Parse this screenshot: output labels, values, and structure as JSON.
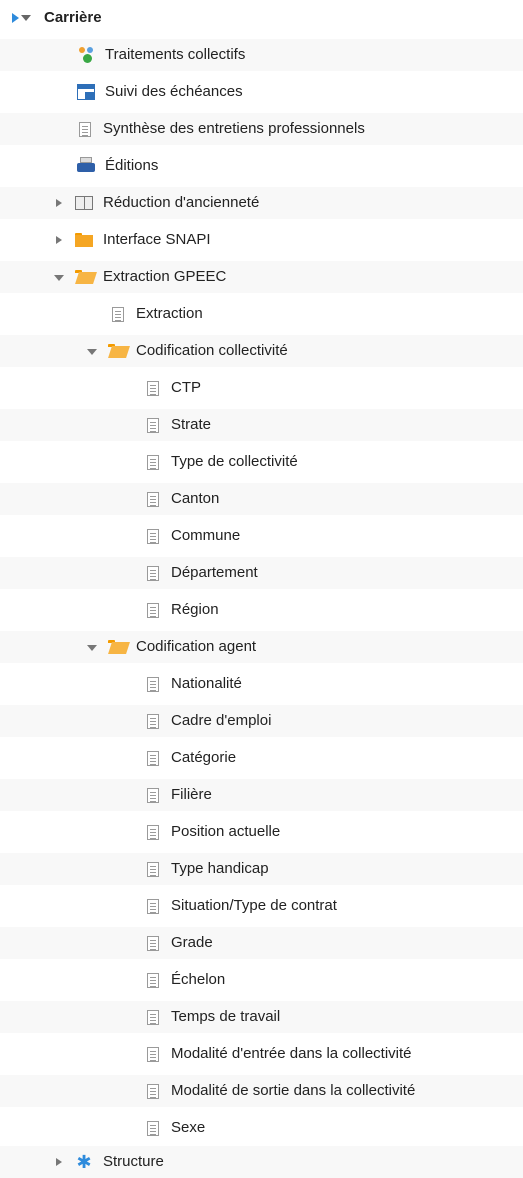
{
  "tree": {
    "root": {
      "label": "Carrière"
    },
    "items": [
      {
        "label": "Traitements collectifs",
        "icon": "team-cog-icon"
      },
      {
        "label": "Suivi des échéances",
        "icon": "calendar-icon"
      },
      {
        "label": "Synthèse des entretiens professionnels",
        "icon": "document-icon"
      },
      {
        "label": "Éditions",
        "icon": "printer-icon"
      },
      {
        "label": "Réduction d'ancienneté",
        "icon": "book-icon"
      },
      {
        "label": "Interface SNAPI",
        "icon": "folder-icon"
      },
      {
        "label": "Extraction GPEEC",
        "icon": "folder-open-icon"
      },
      {
        "label": "Extraction",
        "icon": "document-icon"
      },
      {
        "label": "Codification collectivité",
        "icon": "folder-open-icon"
      },
      {
        "label": "CTP",
        "icon": "document-icon"
      },
      {
        "label": "Strate",
        "icon": "document-icon"
      },
      {
        "label": "Type de collectivité",
        "icon": "document-icon"
      },
      {
        "label": "Canton",
        "icon": "document-icon"
      },
      {
        "label": "Commune",
        "icon": "document-icon"
      },
      {
        "label": "Département",
        "icon": "document-icon"
      },
      {
        "label": "Région",
        "icon": "document-icon"
      },
      {
        "label": "Codification agent",
        "icon": "folder-open-icon"
      },
      {
        "label": "Nationalité",
        "icon": "document-icon"
      },
      {
        "label": "Cadre d'emploi",
        "icon": "document-icon"
      },
      {
        "label": "Catégorie",
        "icon": "document-icon"
      },
      {
        "label": "Filière",
        "icon": "document-icon"
      },
      {
        "label": "Position actuelle",
        "icon": "document-icon"
      },
      {
        "label": "Type handicap",
        "icon": "document-icon"
      },
      {
        "label": "Situation/Type de contrat",
        "icon": "document-icon"
      },
      {
        "label": "Grade",
        "icon": "document-icon"
      },
      {
        "label": "Échelon",
        "icon": "document-icon"
      },
      {
        "label": "Temps de travail",
        "icon": "document-icon"
      },
      {
        "label": "Modalité d'entrée dans la collectivité",
        "icon": "document-icon"
      },
      {
        "label": "Modalité de sortie dans la collectivité",
        "icon": "document-icon"
      },
      {
        "label": "Sexe",
        "icon": "document-icon"
      },
      {
        "label": "Structure",
        "icon": "cog-icon"
      }
    ]
  }
}
